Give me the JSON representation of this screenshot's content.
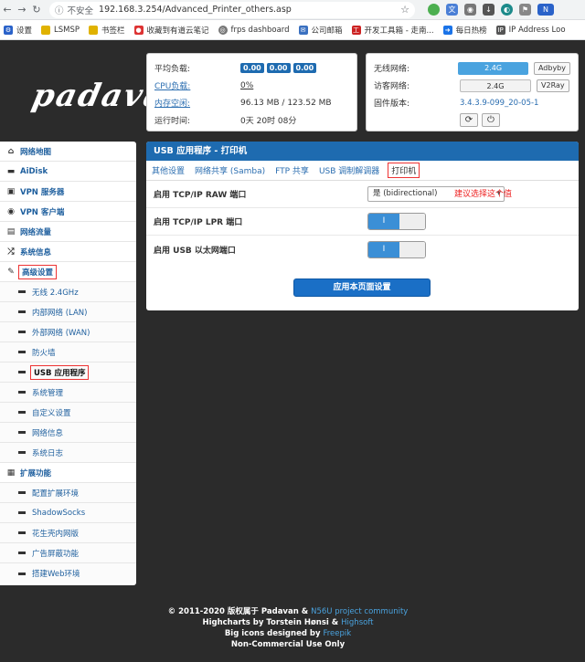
{
  "browser": {
    "insecure_label": "不安全",
    "url": "192.168.3.254/Advanced_Printer_others.asp",
    "bookmarks": [
      "设置",
      "LSMSP",
      "书签栏",
      "收藏到有道云笔记",
      "frps dashboard",
      "公司邮箱",
      "开发工具箱 - 走南...",
      "每日热榜",
      "IP Address Loo"
    ]
  },
  "logo": "padavan",
  "status": {
    "avg_load_label": "平均负载:",
    "avg_load": [
      "0.00",
      "0.00",
      "0.00"
    ],
    "cpu_label": "CPU负载:",
    "cpu_value": "0%",
    "mem_label": "内存空闲:",
    "mem_value": "96.13 MB / 123.52 MB",
    "uptime_label": "运行时间:",
    "uptime_value": "0天 20时 08分",
    "wifi_label": "无线网络:",
    "wifi_band": "2.4G",
    "wifi_btn": "Adbyby",
    "guest_label": "访客网络:",
    "guest_band": "2.4G",
    "guest_btn": "V2Ray",
    "fw_label": "固件版本:",
    "fw_value": "3.4.3.9-099_20-05-1"
  },
  "sidebar": {
    "items": [
      {
        "label": "网络地图",
        "icon": "home-icon"
      },
      {
        "label": "AiDisk",
        "icon": "disk-icon"
      },
      {
        "label": "VPN 服务器",
        "icon": "vpn-icon"
      },
      {
        "label": "VPN 客户端",
        "icon": "globe-icon"
      },
      {
        "label": "网络流量",
        "icon": "traffic-icon"
      },
      {
        "label": "系统信息",
        "icon": "shuffle-icon"
      },
      {
        "label": "高级设置",
        "icon": "wrench-icon"
      }
    ],
    "advanced_sub": [
      "无线 2.4GHz",
      "内部网络 (LAN)",
      "外部网络 (WAN)",
      "防火墙",
      "USB 应用程序",
      "系统管理",
      "自定义设置",
      "网络信息",
      "系统日志"
    ],
    "ext_label": "扩展功能",
    "ext_sub": [
      "配置扩展环境",
      "ShadowSocks",
      "花生壳内网版",
      "广告屏蔽功能",
      "搭建Web环境"
    ]
  },
  "main": {
    "title": "USB 应用程序 - 打印机",
    "tabs": [
      "其他设置",
      "网络共享 (Samba)",
      "FTP 共享",
      "USB 调制解调器",
      "打印机"
    ],
    "rows": [
      {
        "label": "启用 TCP/IP RAW 端口",
        "select": "是 (bidirectional)",
        "hint": "建议选择这个值"
      },
      {
        "label": "启用 TCP/IP LPR 端口",
        "toggle": "I"
      },
      {
        "label": "启用 USB 以太网端口",
        "toggle": "I"
      }
    ],
    "apply_label": "应用本页面设置"
  },
  "footer": {
    "line1_pre": "© 2011-2020 版权属于 Padavan & ",
    "line1_link": "N56U project community",
    "line2_pre": "Highcharts by Torstein Hønsi & ",
    "line2_link": "Highsoft",
    "line3_pre": "Big icons designed by ",
    "line3_link": "Freepik",
    "line4": "Non-Commercial Use Only"
  },
  "colors": {
    "accent": "#1e6bb0",
    "hint": "#e22",
    "highlight_box": "#e33"
  }
}
